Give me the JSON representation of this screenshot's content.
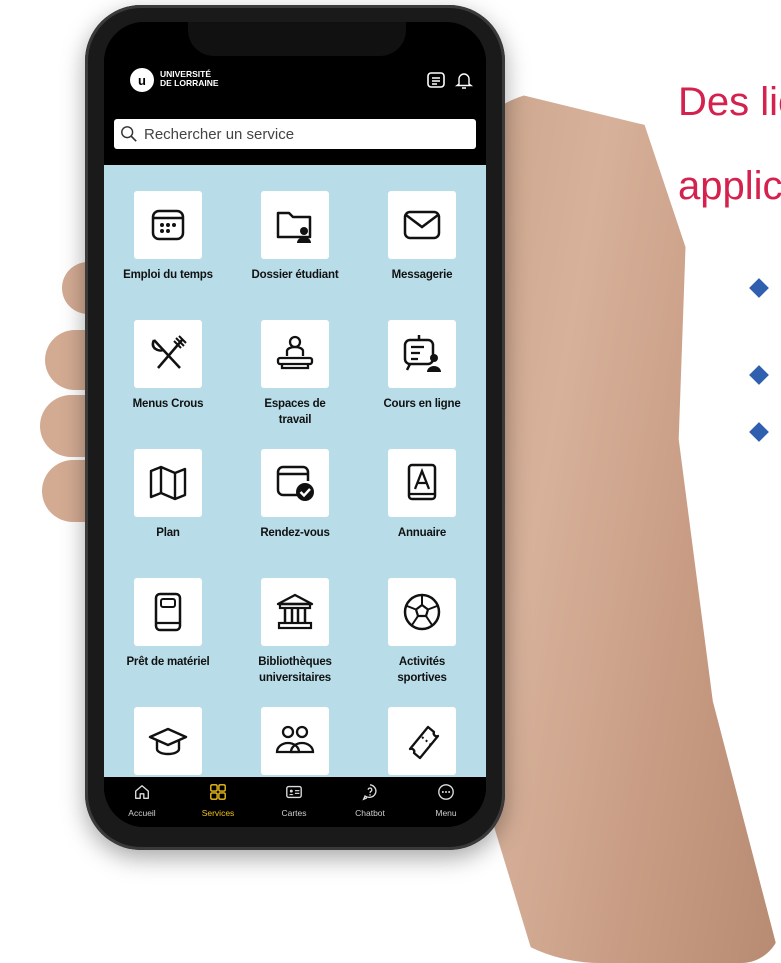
{
  "slide": {
    "headline_line1": "Des lie",
    "headline_line2": "applic"
  },
  "app": {
    "logo_text_line1": "UNIVERSITÉ",
    "logo_text_line2": "DE LORRAINE",
    "search_placeholder": "Rechercher un service"
  },
  "services": [
    {
      "label_line1": "Emploi du temps",
      "label_line2": "",
      "icon": "calendar-icon"
    },
    {
      "label_line1": "Dossier étudiant",
      "label_line2": "",
      "icon": "folder-user-icon"
    },
    {
      "label_line1": "Messagerie",
      "label_line2": "",
      "icon": "mail-icon"
    },
    {
      "label_line1": "Menus Crous",
      "label_line2": "",
      "icon": "fork-knife-icon"
    },
    {
      "label_line1": "Espaces de",
      "label_line2": "travail",
      "icon": "workspace-icon"
    },
    {
      "label_line1": "Cours en ligne",
      "label_line2": "",
      "icon": "online-course-icon"
    },
    {
      "label_line1": "Plan",
      "label_line2": "",
      "icon": "map-icon"
    },
    {
      "label_line1": "Rendez-vous",
      "label_line2": "",
      "icon": "appointment-icon"
    },
    {
      "label_line1": "Annuaire",
      "label_line2": "",
      "icon": "directory-icon"
    },
    {
      "label_line1": "Prêt de matériel",
      "label_line2": "",
      "icon": "tablet-icon"
    },
    {
      "label_line1": "Bibliothèques",
      "label_line2": "universitaires",
      "icon": "library-icon"
    },
    {
      "label_line1": "Activités",
      "label_line2": "sportives",
      "icon": "soccer-ball-icon"
    },
    {
      "label_line1": "",
      "label_line2": "",
      "icon": "graduation-cap-icon"
    },
    {
      "label_line1": "",
      "label_line2": "",
      "icon": "group-icon"
    },
    {
      "label_line1": "",
      "label_line2": "",
      "icon": "ticket-icon"
    }
  ],
  "nav": [
    {
      "label": "Accueil",
      "icon": "home-icon",
      "active": false
    },
    {
      "label": "Services",
      "icon": "grid-icon",
      "active": true
    },
    {
      "label": "Cartes",
      "icon": "id-card-icon",
      "active": false
    },
    {
      "label": "Chatbot",
      "icon": "chatbot-icon",
      "active": false
    },
    {
      "label": "Menu",
      "icon": "more-icon",
      "active": false
    }
  ],
  "colors": {
    "accent_red": "#d4214d",
    "bullet_blue": "#2f5fae",
    "grid_background": "#b8dde9",
    "nav_active": "#f2c21b"
  }
}
